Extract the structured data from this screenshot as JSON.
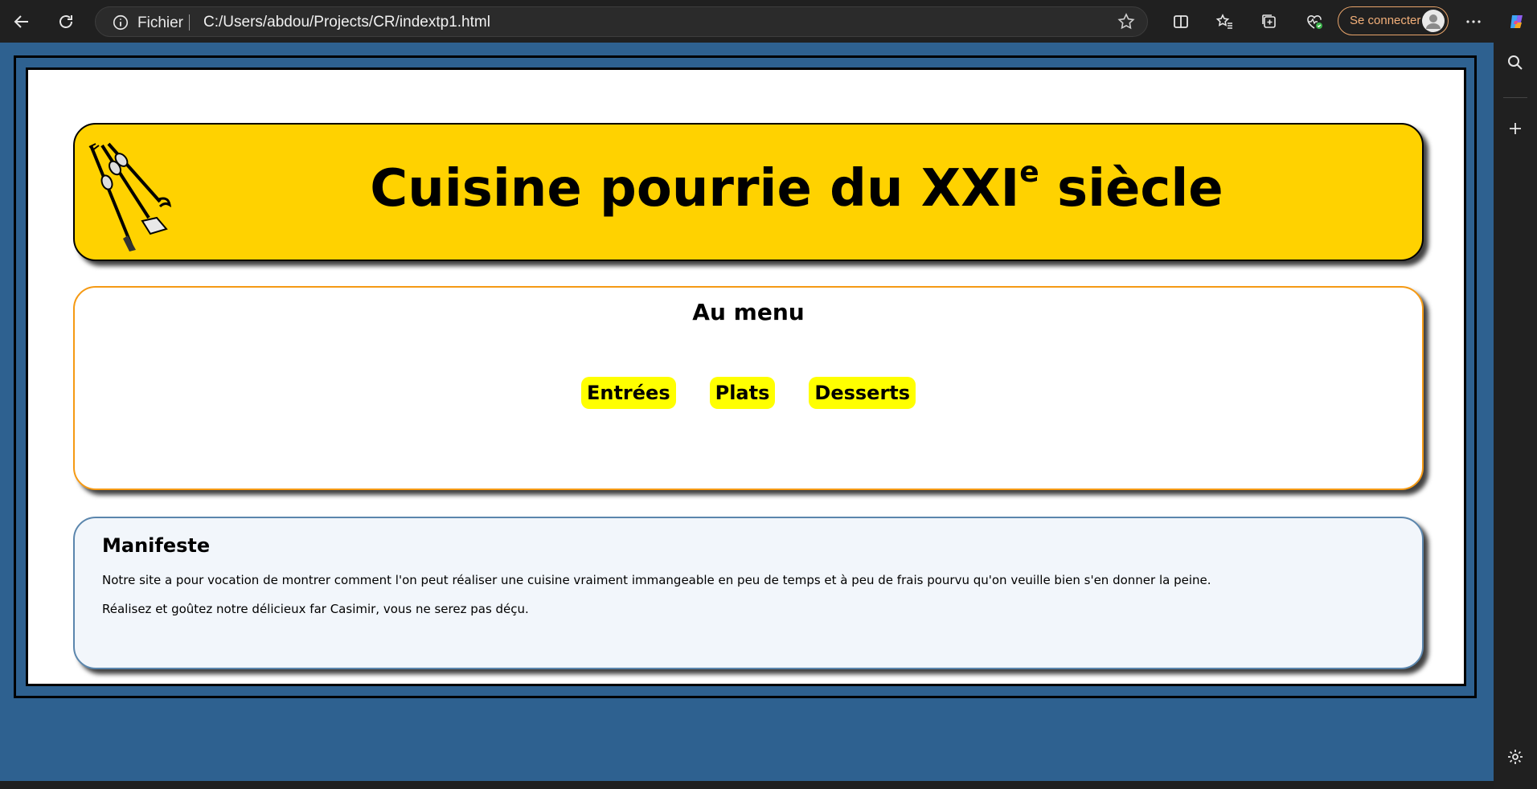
{
  "browser": {
    "address_label": "Fichier",
    "url": "C:/Users/abdou/Projects/CR/indextp1.html",
    "signin_label": "Se connecter"
  },
  "page": {
    "site_title": "Cuisine pourrie du XXI",
    "site_title_sup": "e",
    "site_title_end": " siècle",
    "menu": {
      "title": "Au menu",
      "links": [
        "Entrées",
        "Plats",
        "Desserts"
      ]
    },
    "manifeste": {
      "title": "Manifeste",
      "paragraphs": [
        "Notre site a pour vocation de montrer comment l'on peut réaliser une cuisine vraiment immangeable en peu de temps et à peu de frais pourvu qu'on veuille bien s'en donner la peine.",
        "Réalisez et goûtez notre délicieux far Casimir, vous ne serez pas déçu."
      ]
    }
  },
  "colors": {
    "header_bg": "#ffd200",
    "menu_border": "#f59a14",
    "menu_link_bg": "#ffff00",
    "page_bg": "#2e6190",
    "manifeste_bg": "#f2f6fb"
  }
}
